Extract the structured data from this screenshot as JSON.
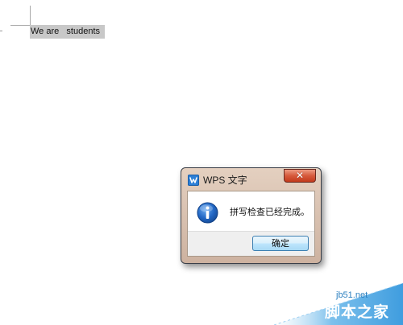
{
  "document": {
    "text": "We are   students"
  },
  "dialog": {
    "title": "WPS 文字",
    "app_icon": "wps-writer-icon",
    "close_icon": "close-icon",
    "close_glyph": "✕",
    "message_icon": "info-icon",
    "message": "拼写检查已经完成。",
    "ok_label": "确定"
  },
  "watermark": {
    "domain": "jb51.net",
    "name": "脚本之家"
  },
  "colors": {
    "selection": "#c8c8c8",
    "dialog_frame": "#d8bfae",
    "close_button": "#d65a3c",
    "ok_button": "#bee6fd",
    "info_icon": "#1a5fb4",
    "watermark_blue": "#2a7fbf"
  }
}
